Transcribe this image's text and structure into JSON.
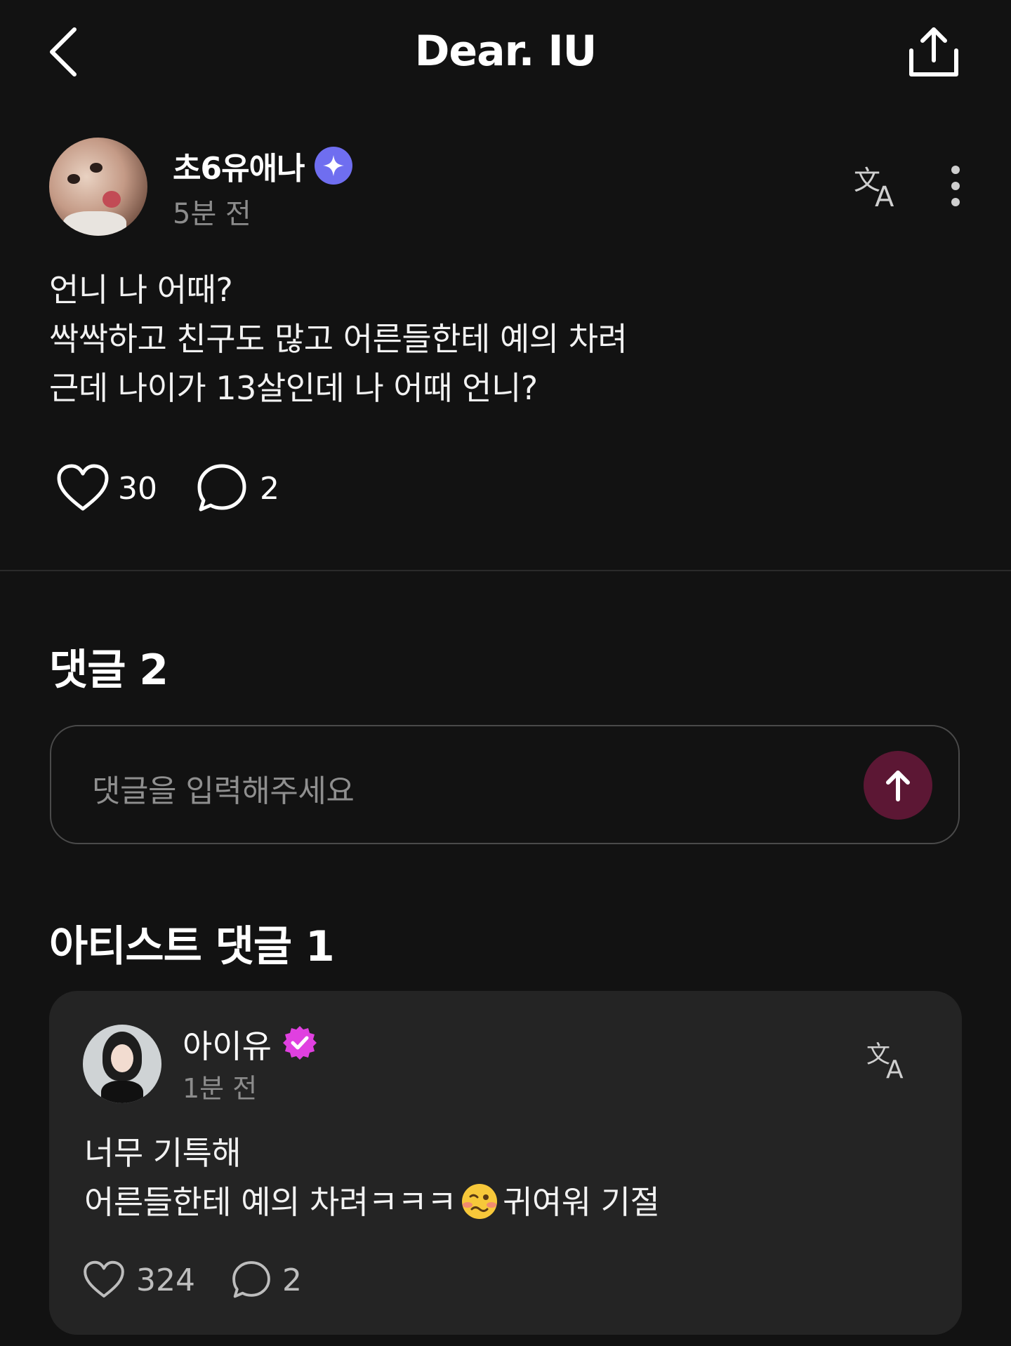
{
  "header": {
    "title": "Dear. IU"
  },
  "post": {
    "username": "초6유애나",
    "time": "5분 전",
    "body_lines": [
      "언니 나 어때?",
      "싹싹하고 친구도 많고 어른들한테 예의 차려",
      "근데 나이가 13살인데 나 어때 언니?"
    ],
    "like_count": "30",
    "comment_count": "2"
  },
  "comments": {
    "title": "댓글 2",
    "input_placeholder": "댓글을 입력해주세요"
  },
  "artist_comments": {
    "title": "아티스트 댓글 1",
    "items": [
      {
        "name": "아이유",
        "time": "1분 전",
        "line1": "너무 기특해",
        "line2_before": "어른들한테 예의 차려ㅋㅋㅋ",
        "line2_after": "귀여워 기절",
        "like_count": "324",
        "comment_count": "2"
      }
    ]
  },
  "colors": {
    "background": "#121212",
    "card": "#242424",
    "badge_user": "#6f6ef0",
    "badge_artist": "#e040e0",
    "send_button": "#5c1734"
  },
  "icons": [
    "back-icon",
    "share-icon",
    "translate-icon",
    "more-icon",
    "heart-icon",
    "comment-icon",
    "send-arrow-icon",
    "verified-badge-icon",
    "woozy-face-emoji"
  ]
}
